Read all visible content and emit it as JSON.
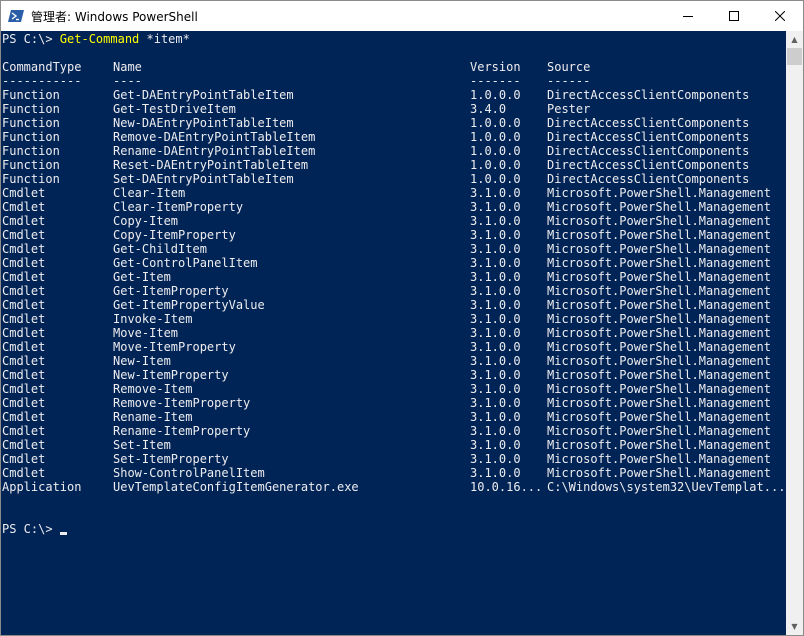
{
  "window": {
    "title": "管理者: Windows PowerShell"
  },
  "icons": {
    "app": "powershell-icon",
    "minimize": "minimize-icon",
    "maximize": "maximize-icon",
    "close": "close-icon"
  },
  "colors": {
    "console_background": "#012456",
    "console_text": "#eeedf0",
    "command_highlight": "#ffff00"
  },
  "console": {
    "prompt1": "PS C:\\> ",
    "command_name": "Get-Command",
    "command_args": " *item*",
    "columns": {
      "type": "CommandType",
      "name": "Name",
      "version": "Version",
      "source": "Source"
    },
    "separators": {
      "type": "-----------",
      "name": "----",
      "version": "-------",
      "source": "------"
    },
    "rows": [
      {
        "type": "Function",
        "name": "Get-DAEntryPointTableItem",
        "version": "1.0.0.0",
        "source": "DirectAccessClientComponents"
      },
      {
        "type": "Function",
        "name": "Get-TestDriveItem",
        "version": "3.4.0",
        "source": "Pester"
      },
      {
        "type": "Function",
        "name": "New-DAEntryPointTableItem",
        "version": "1.0.0.0",
        "source": "DirectAccessClientComponents"
      },
      {
        "type": "Function",
        "name": "Remove-DAEntryPointTableItem",
        "version": "1.0.0.0",
        "source": "DirectAccessClientComponents"
      },
      {
        "type": "Function",
        "name": "Rename-DAEntryPointTableItem",
        "version": "1.0.0.0",
        "source": "DirectAccessClientComponents"
      },
      {
        "type": "Function",
        "name": "Reset-DAEntryPointTableItem",
        "version": "1.0.0.0",
        "source": "DirectAccessClientComponents"
      },
      {
        "type": "Function",
        "name": "Set-DAEntryPointTableItem",
        "version": "1.0.0.0",
        "source": "DirectAccessClientComponents"
      },
      {
        "type": "Cmdlet",
        "name": "Clear-Item",
        "version": "3.1.0.0",
        "source": "Microsoft.PowerShell.Management"
      },
      {
        "type": "Cmdlet",
        "name": "Clear-ItemProperty",
        "version": "3.1.0.0",
        "source": "Microsoft.PowerShell.Management"
      },
      {
        "type": "Cmdlet",
        "name": "Copy-Item",
        "version": "3.1.0.0",
        "source": "Microsoft.PowerShell.Management"
      },
      {
        "type": "Cmdlet",
        "name": "Copy-ItemProperty",
        "version": "3.1.0.0",
        "source": "Microsoft.PowerShell.Management"
      },
      {
        "type": "Cmdlet",
        "name": "Get-ChildItem",
        "version": "3.1.0.0",
        "source": "Microsoft.PowerShell.Management"
      },
      {
        "type": "Cmdlet",
        "name": "Get-ControlPanelItem",
        "version": "3.1.0.0",
        "source": "Microsoft.PowerShell.Management"
      },
      {
        "type": "Cmdlet",
        "name": "Get-Item",
        "version": "3.1.0.0",
        "source": "Microsoft.PowerShell.Management"
      },
      {
        "type": "Cmdlet",
        "name": "Get-ItemProperty",
        "version": "3.1.0.0",
        "source": "Microsoft.PowerShell.Management"
      },
      {
        "type": "Cmdlet",
        "name": "Get-ItemPropertyValue",
        "version": "3.1.0.0",
        "source": "Microsoft.PowerShell.Management"
      },
      {
        "type": "Cmdlet",
        "name": "Invoke-Item",
        "version": "3.1.0.0",
        "source": "Microsoft.PowerShell.Management"
      },
      {
        "type": "Cmdlet",
        "name": "Move-Item",
        "version": "3.1.0.0",
        "source": "Microsoft.PowerShell.Management"
      },
      {
        "type": "Cmdlet",
        "name": "Move-ItemProperty",
        "version": "3.1.0.0",
        "source": "Microsoft.PowerShell.Management"
      },
      {
        "type": "Cmdlet",
        "name": "New-Item",
        "version": "3.1.0.0",
        "source": "Microsoft.PowerShell.Management"
      },
      {
        "type": "Cmdlet",
        "name": "New-ItemProperty",
        "version": "3.1.0.0",
        "source": "Microsoft.PowerShell.Management"
      },
      {
        "type": "Cmdlet",
        "name": "Remove-Item",
        "version": "3.1.0.0",
        "source": "Microsoft.PowerShell.Management"
      },
      {
        "type": "Cmdlet",
        "name": "Remove-ItemProperty",
        "version": "3.1.0.0",
        "source": "Microsoft.PowerShell.Management"
      },
      {
        "type": "Cmdlet",
        "name": "Rename-Item",
        "version": "3.1.0.0",
        "source": "Microsoft.PowerShell.Management"
      },
      {
        "type": "Cmdlet",
        "name": "Rename-ItemProperty",
        "version": "3.1.0.0",
        "source": "Microsoft.PowerShell.Management"
      },
      {
        "type": "Cmdlet",
        "name": "Set-Item",
        "version": "3.1.0.0",
        "source": "Microsoft.PowerShell.Management"
      },
      {
        "type": "Cmdlet",
        "name": "Set-ItemProperty",
        "version": "3.1.0.0",
        "source": "Microsoft.PowerShell.Management"
      },
      {
        "type": "Cmdlet",
        "name": "Show-ControlPanelItem",
        "version": "3.1.0.0",
        "source": "Microsoft.PowerShell.Management"
      },
      {
        "type": "Application",
        "name": "UevTemplateConfigItemGenerator.exe",
        "version": "10.0.16...",
        "source": "C:\\Windows\\system32\\UevTemplat..."
      }
    ],
    "prompt2": "PS C:\\> "
  }
}
